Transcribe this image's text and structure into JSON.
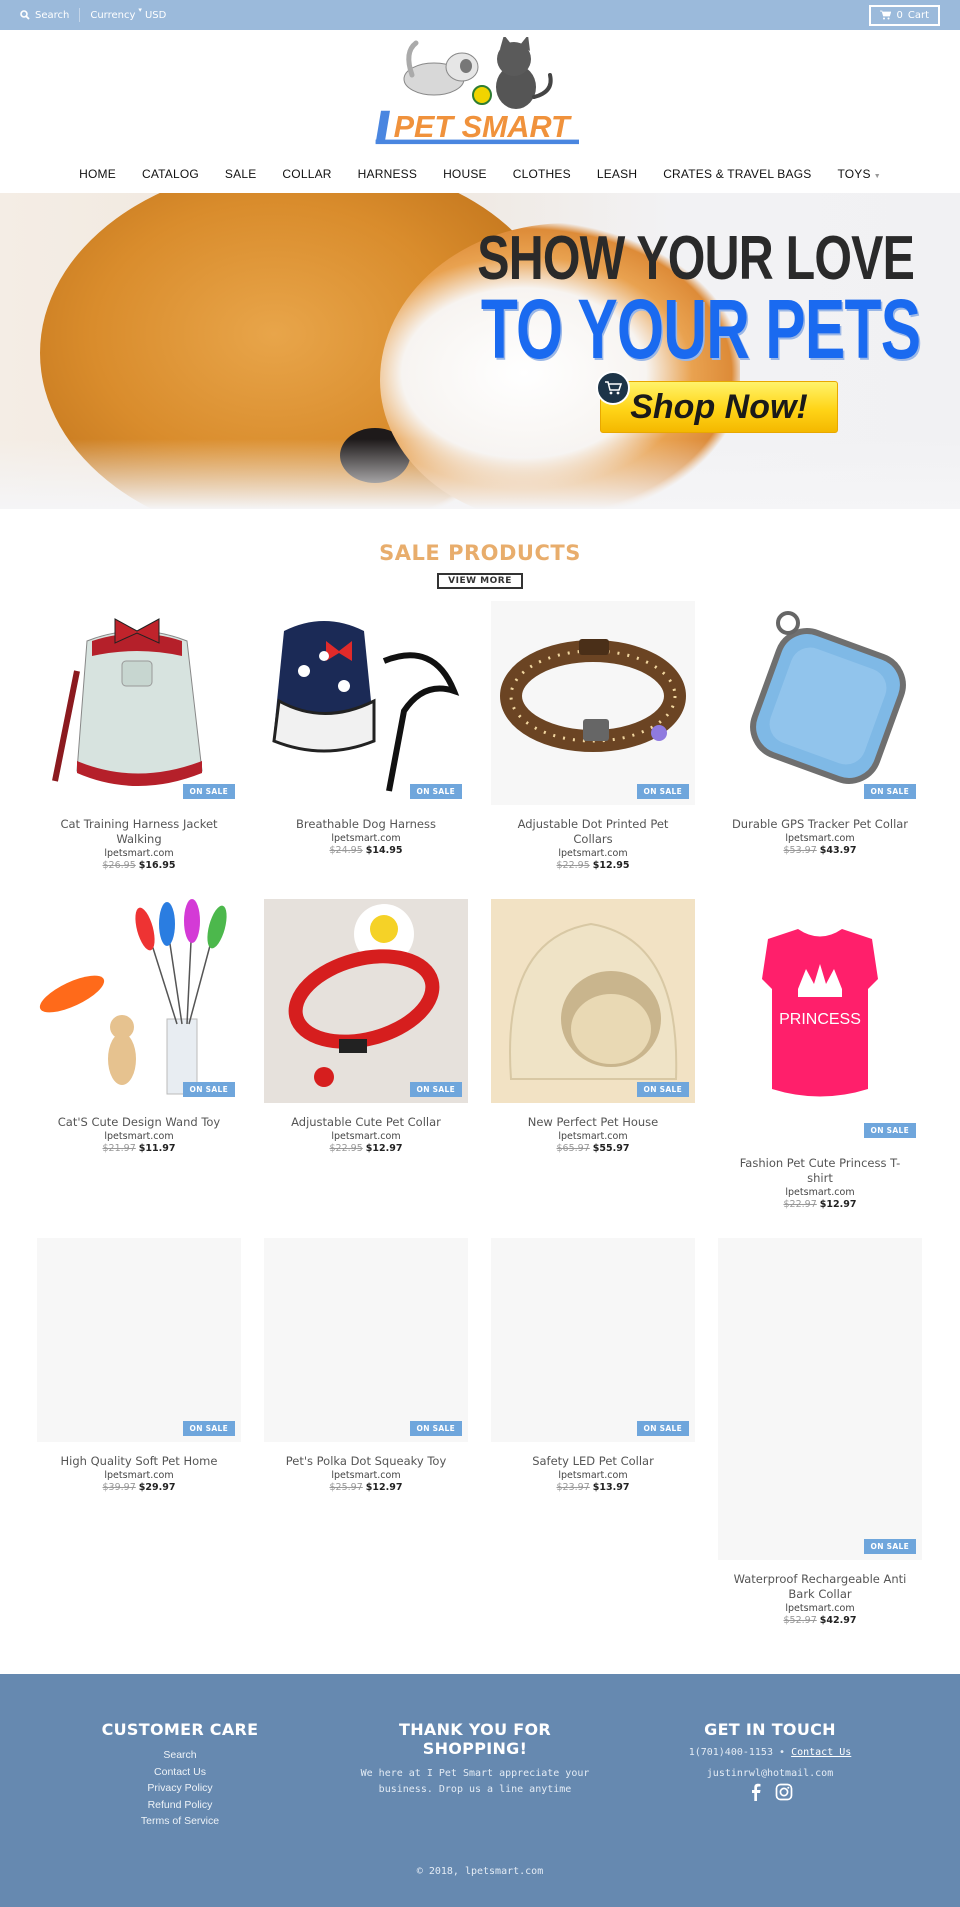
{
  "topbar": {
    "search_label": "Search",
    "currency_label": "Currency",
    "currency_value": "USD",
    "cart_count": "0",
    "cart_label": "Cart"
  },
  "logo": {
    "text": "PET SMART",
    "letter": "l",
    "colors": {
      "blue": "#4a86e0",
      "orange": "#f0923c"
    }
  },
  "nav": {
    "items": [
      {
        "label": "HOME"
      },
      {
        "label": "CATALOG"
      },
      {
        "label": "SALE"
      },
      {
        "label": "COLLAR"
      },
      {
        "label": "HARNESS"
      },
      {
        "label": "HOUSE"
      },
      {
        "label": "CLOTHES"
      },
      {
        "label": "LEASH"
      },
      {
        "label": "CRATES & TRAVEL BAGS"
      },
      {
        "label": "TOYS",
        "has_dropdown": true
      }
    ]
  },
  "hero": {
    "line1": "SHOW YOUR LOVE",
    "line2": "TO YOUR PETS",
    "cta": "Shop Now!"
  },
  "sale": {
    "title": "SALE PRODUCTS",
    "view_more": "VIEW MORE",
    "badge": "ON SALE",
    "products": [
      {
        "title": "Cat Training Harness Jacket Walking",
        "vendor": "lpetsmart.com",
        "old_price": "$26.95",
        "price": "$16.95",
        "image": "harness-jacket"
      },
      {
        "title": "Breathable Dog Harness",
        "vendor": "lpetsmart.com",
        "old_price": "$24.95",
        "price": "$14.95",
        "image": "dog-harness"
      },
      {
        "title": "Adjustable Dot Printed Pet Collars",
        "vendor": "lpetsmart.com",
        "old_price": "$22.95",
        "price": "$12.95",
        "image": "dot-collar"
      },
      {
        "title": "Durable GPS Tracker Pet Collar",
        "vendor": "lpetsmart.com",
        "old_price": "$53.97",
        "price": "$43.97",
        "image": "gps-tracker"
      },
      {
        "title": "Cat'S Cute Design Wand Toy",
        "vendor": "lpetsmart.com",
        "old_price": "$21.97",
        "price": "$11.97",
        "image": "wand-toy"
      },
      {
        "title": "Adjustable Cute Pet Collar",
        "vendor": "lpetsmart.com",
        "old_price": "$22.95",
        "price": "$12.97",
        "image": "red-collar"
      },
      {
        "title": "New Perfect Pet House",
        "vendor": "lpetsmart.com",
        "old_price": "$65.97",
        "price": "$55.97",
        "image": "pet-house"
      },
      {
        "title": "Fashion Pet Cute Princess T-shirt",
        "vendor": "lpetsmart.com",
        "old_price": "$22.97",
        "price": "$12.97",
        "image": "princess-shirt"
      },
      {
        "title": "High Quality Soft Pet Home",
        "vendor": "lpetsmart.com",
        "old_price": "$39.97",
        "price": "$29.97",
        "image": "placeholder"
      },
      {
        "title": "Pet's Polka Dot Squeaky Toy",
        "vendor": "lpetsmart.com",
        "old_price": "$25.97",
        "price": "$12.97",
        "image": "placeholder"
      },
      {
        "title": "Safety LED Pet Collar",
        "vendor": "lpetsmart.com",
        "old_price": "$23.97",
        "price": "$13.97",
        "image": "placeholder"
      },
      {
        "title": "Waterproof Rechargeable Anti Bark Collar",
        "vendor": "lpetsmart.com",
        "old_price": "$52.97",
        "price": "$42.97",
        "image": "placeholder"
      }
    ],
    "princess_print": "PRINCESS"
  },
  "footer": {
    "customer_care": {
      "title": "CUSTOMER CARE",
      "links": [
        "Search",
        "Contact Us",
        "Privacy Policy",
        "Refund Policy",
        "Terms of Service"
      ]
    },
    "thanks": {
      "title": "THANK YOU FOR SHOPPING!",
      "text": "We here at I Pet Smart appreciate your business. Drop us a line anytime"
    },
    "contact": {
      "title": "GET IN TOUCH",
      "phone": "1(701)400-1153",
      "separator": "•",
      "contact_link": "Contact Us",
      "email": "justinrwl@hotmail.com"
    },
    "copyright": "© 2018, lpetsmart.com",
    "colors": {
      "background": "#6689b0"
    }
  }
}
